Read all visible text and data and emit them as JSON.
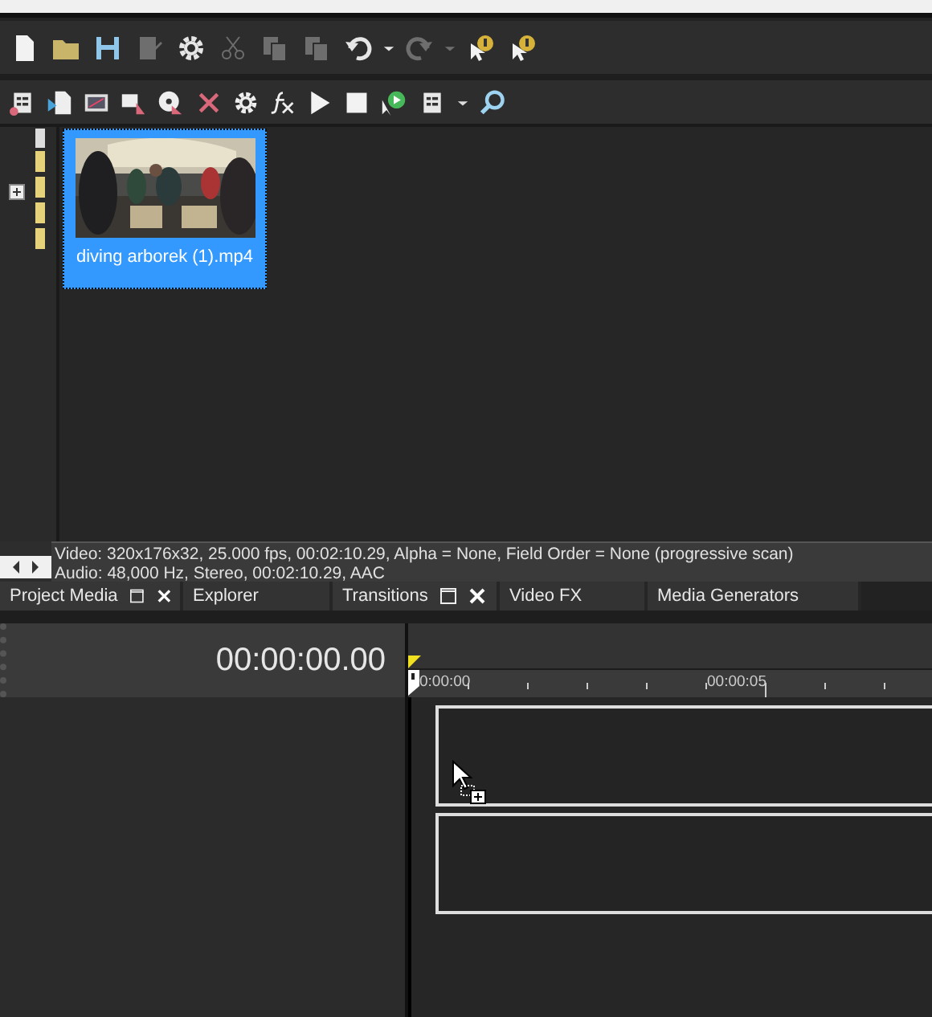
{
  "main_toolbar": [
    {
      "disabled": false
    },
    {
      "disabled": false
    },
    {
      "disabled": false
    },
    {
      "disabled": true
    },
    {
      "disabled": false
    },
    {
      "disabled": true
    },
    {
      "disabled": true
    },
    {
      "disabled": true
    },
    {
      "disabled": false
    },
    {
      "disabled": false
    },
    {
      "disabled": true
    },
    {
      "disabled": true
    },
    {
      "disabled": false
    },
    {
      "disabled": false
    }
  ],
  "media_toolbar": [
    {
      "disabled": false
    },
    {
      "disabled": false
    },
    {
      "disabled": false
    },
    {
      "disabled": false
    },
    {
      "disabled": false
    },
    {
      "disabled": false
    },
    {
      "disabled": false
    },
    {
      "disabled": false
    },
    {
      "disabled": false
    },
    {
      "disabled": false
    },
    {
      "disabled": false
    },
    {
      "disabled": false
    },
    {
      "disabled": false
    },
    {
      "disabled": false
    }
  ],
  "media_items": [
    {
      "name": "diving arborek (1).mp4",
      "selected": true
    }
  ],
  "media_info": [
    "Video: 320x176x32, 25.000 fps, 00:02:10.29, Alpha = None, Field Order = None (progressive scan)",
    "Audio: 48,000 Hz, Stereo, 00:02:10.29, AAC"
  ],
  "tabs": [
    {
      "label": "Project Media",
      "selected": true
    },
    {
      "label": "Explorer",
      "selected": false
    },
    {
      "label": "Transitions",
      "selected": true
    },
    {
      "label": "Video FX",
      "selected": false
    },
    {
      "label": "Media Generators",
      "selected": false
    }
  ],
  "timeline": {
    "time": "00:00:00.00",
    "ruler_labels": [
      "0:00:00",
      "00:00:05"
    ]
  }
}
